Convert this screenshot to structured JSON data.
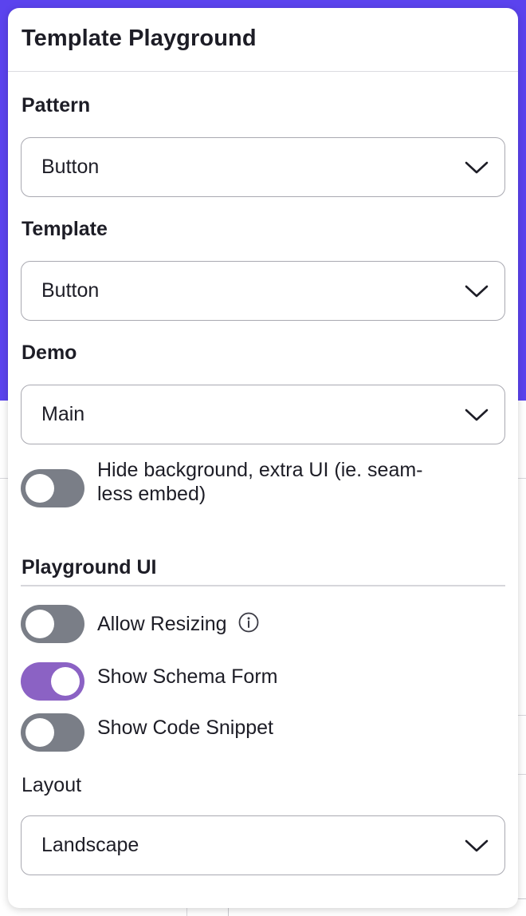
{
  "panel": {
    "title": "Template Playground"
  },
  "fields": {
    "pattern": {
      "label": "Pattern",
      "value": "Button"
    },
    "template": {
      "label": "Template",
      "value": "Button"
    },
    "demo": {
      "label": "Demo",
      "value": "Main"
    }
  },
  "hide_background": {
    "label_line1": "Hide background, extra UI (ie. seam-",
    "label_line2": "less embed)",
    "on": false
  },
  "playground_ui": {
    "title": "Playground UI",
    "allow_resizing": {
      "label": "Allow Resizing",
      "on": false
    },
    "show_schema_form": {
      "label": "Show Schema Form",
      "on": true
    },
    "show_code_snippet": {
      "label": "Show Code Snippet",
      "on": false
    }
  },
  "layout": {
    "label": "Layout",
    "value": "Landscape"
  },
  "colors": {
    "background_accent": "#5b43ee",
    "toggle_on": "#8b62c4",
    "toggle_off": "#7a7e87"
  },
  "icons": {
    "select_caret": "chevron-down-icon",
    "info": "info-icon"
  }
}
